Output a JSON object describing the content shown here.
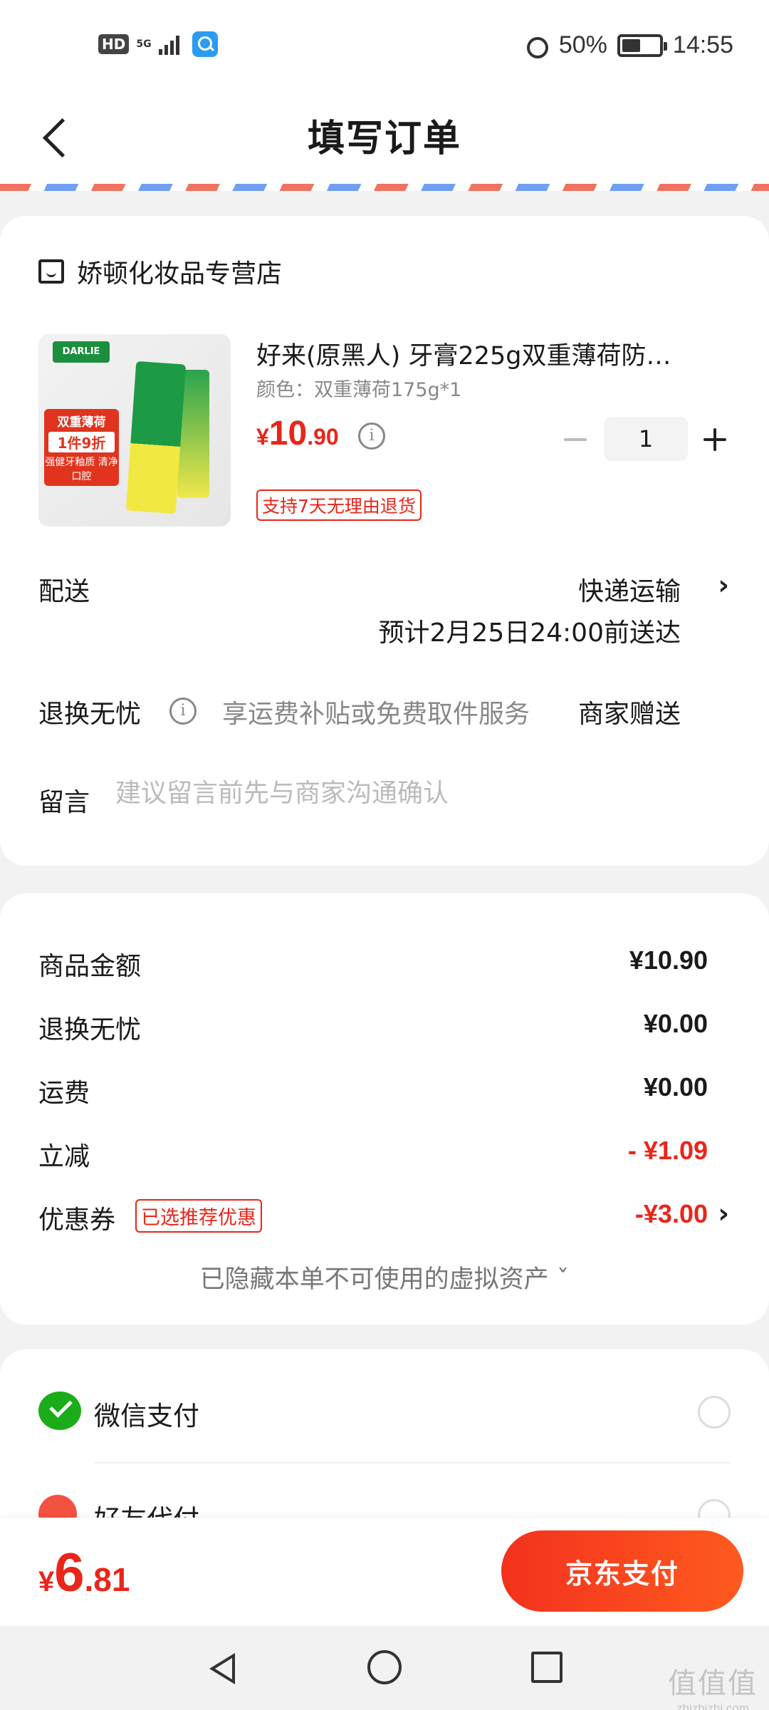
{
  "status_bar": {
    "hd": "HD",
    "network": "5G",
    "battery_text": "50%",
    "battery_level": 0.5,
    "time": "14:55"
  },
  "header": {
    "title": "填写订单"
  },
  "store": {
    "name": "娇顿化妆品专营店"
  },
  "product": {
    "image_brand": "DARLIE",
    "image_tag_line1": "双重薄荷",
    "image_tag_line2": "1件9折",
    "image_tag_line3": "强健牙釉质 清净口腔",
    "title": "好来(原黑人) 牙膏225g双重薄荷防…",
    "variant": "颜色：双重薄荷175g*1",
    "price_currency": "¥",
    "price_integer": "10",
    "price_decimal": ".90",
    "quantity": "1",
    "return_badge": "支持7天无理由退货"
  },
  "delivery": {
    "label": "配送",
    "method": "快递运输",
    "eta": "预计2月25日24:00前送达"
  },
  "return_service": {
    "label": "退换无忧",
    "description": "享运费补贴或免费取件服务",
    "provider": "商家赠送"
  },
  "message": {
    "label": "留言",
    "placeholder": "建议留言前先与商家沟通确认"
  },
  "summary": {
    "rows": [
      {
        "label": "商品金额",
        "value": "¥10.90"
      },
      {
        "label": "退换无忧",
        "value": "¥0.00"
      },
      {
        "label": "运费",
        "value": "¥0.00"
      },
      {
        "label": "立减",
        "value": "- ¥1.09"
      },
      {
        "label": "优惠券",
        "badge": "已选推荐优惠",
        "value": "-¥3.00"
      }
    ],
    "hidden_assets": "已隐藏本单不可使用的虚拟资产 ˇ"
  },
  "payment": {
    "methods": [
      {
        "label": "微信支付",
        "icon": "wechat-icon"
      },
      {
        "label": "好友代付",
        "icon": "heart-icon"
      }
    ]
  },
  "bottom": {
    "total_currency": "¥",
    "total_integer": "6",
    "total_decimal": ".81",
    "pay_button": "京东支付"
  },
  "watermark": {
    "line1": "值值值",
    "line2": "zhizhizhi.com"
  },
  "colors": {
    "accent": "#e8261a",
    "button_gradient_start": "#f3321d",
    "button_gradient_end": "#ff5a1f",
    "wechat": "#1aad19"
  }
}
